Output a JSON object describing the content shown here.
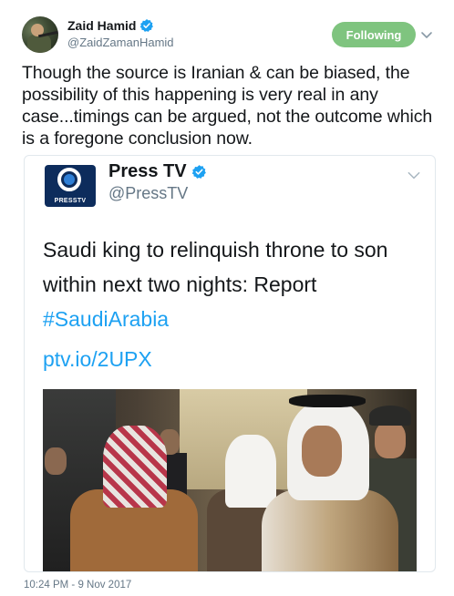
{
  "tweet": {
    "author": {
      "display_name": "Zaid Hamid",
      "handle": "@ZaidZamanHamid",
      "verified": true
    },
    "follow_button": {
      "label": "Following",
      "color": "#7fc47f"
    },
    "text": "Though the source is Iranian & can be biased, the possibility of this happening is very real in any case...timings can be argued, not the outcome which is a foregone conclusion now.",
    "timestamp": "10:24 PM - 9 Nov 2017"
  },
  "quoted_tweet": {
    "author": {
      "display_name": "Press TV",
      "handle": "@PressTV",
      "verified": true,
      "logo_text": "PRESSTV"
    },
    "text_lines": [
      "Saudi king to relinquish throne to son",
      "within next two nights: Report"
    ],
    "hashtag": "#SaudiArabia",
    "url": "ptv.io/2UPX"
  },
  "colors": {
    "link": "#1da1f2",
    "verified": "#1da1f2",
    "secondary_text": "#657786"
  }
}
